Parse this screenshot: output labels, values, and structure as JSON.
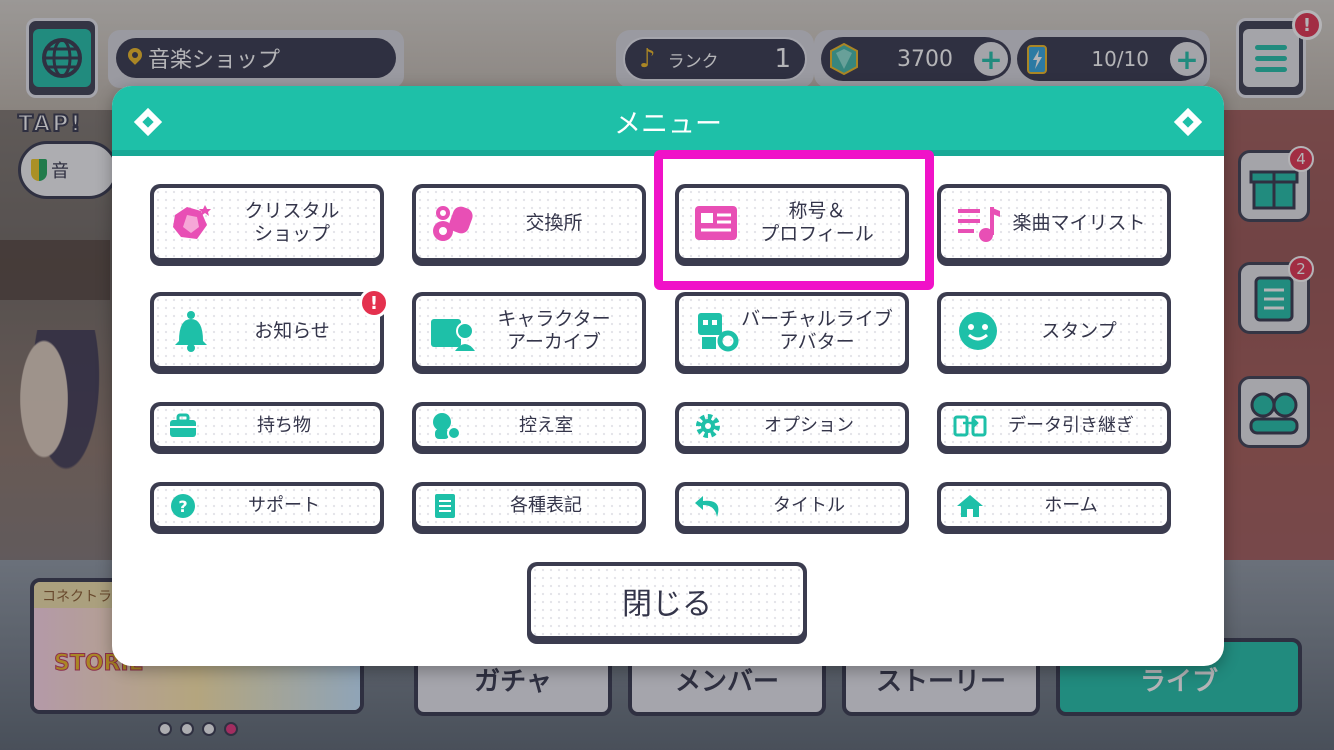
{
  "hud": {
    "location": "音楽ショップ",
    "rank_label": "ランク",
    "rank_value": "1",
    "gems": "3700",
    "stamina": "10/10",
    "menu_alert": "!"
  },
  "side": {
    "gift_count": "4",
    "mission_count": "2"
  },
  "tap": {
    "label": "TAP!",
    "bubble_text": "音"
  },
  "bottom": {
    "banner_title": "コネクトライ",
    "banner_art_text": "STORIE",
    "nav": [
      "ガチャ",
      "メンバー",
      "ストーリー",
      "ライブ"
    ]
  },
  "modal": {
    "title": "メニュー",
    "items": [
      {
        "label": "クリスタル\nショップ",
        "icon": "crystal-shop-icon"
      },
      {
        "label": "交換所",
        "icon": "exchange-icon"
      },
      {
        "label": "称号＆\nプロフィール",
        "icon": "profile-card-icon"
      },
      {
        "label": "楽曲マイリスト",
        "icon": "music-list-icon"
      },
      {
        "label": "お知らせ",
        "icon": "bell-icon",
        "alert": "!"
      },
      {
        "label": "キャラクター\nアーカイブ",
        "icon": "character-archive-icon"
      },
      {
        "label": "バーチャルライブ\nアバター",
        "icon": "avatar-icon"
      },
      {
        "label": "スタンプ",
        "icon": "smiley-stamp-icon"
      },
      {
        "label": "持ち物",
        "icon": "bag-icon"
      },
      {
        "label": "控え室",
        "icon": "waiting-room-icon"
      },
      {
        "label": "オプション",
        "icon": "gear-icon"
      },
      {
        "label": "データ引き継ぎ",
        "icon": "data-transfer-icon"
      },
      {
        "label": "サポート",
        "icon": "help-icon"
      },
      {
        "label": "各種表記",
        "icon": "document-icon"
      },
      {
        "label": "タイトル",
        "icon": "return-arrow-icon"
      },
      {
        "label": "ホーム",
        "icon": "home-icon"
      }
    ],
    "close_label": "閉じる"
  },
  "colors": {
    "accent": "#1ec0a8",
    "highlight": "#f012c8",
    "dark": "#34354a",
    "alert": "#e4314e",
    "profile_pink": "#e84fb5"
  }
}
